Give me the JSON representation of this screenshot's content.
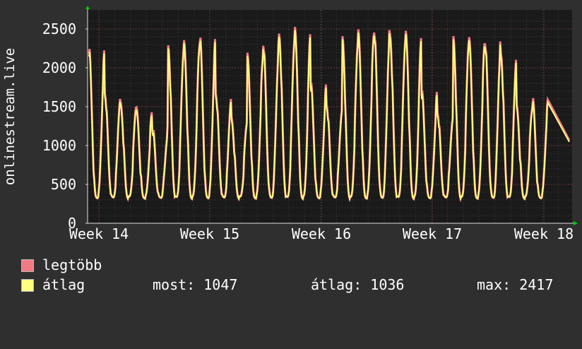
{
  "chart_data": {
    "type": "line",
    "ylabel": "onlinestream.live",
    "ylim": [
      0,
      2500
    ],
    "yticks": [
      0,
      500,
      1000,
      1500,
      2000,
      2500
    ],
    "xticks": [
      "Week 14",
      "Week 15",
      "Week 16",
      "Week 17",
      "Week 18"
    ],
    "grid": true,
    "legend_position": "bottom-left",
    "daily_peaks": [
      2200,
      1650,
      1500,
      1400,
      1200,
      2250,
      2280,
      2350,
      1650,
      1300,
      2100,
      2280,
      2400,
      2450,
      1750,
      1500,
      2350,
      2400,
      2450,
      2400,
      2400,
      1650,
      1400,
      2350,
      2300,
      2300,
      2150,
      1450,
      1550
    ],
    "daily_trough": 330,
    "last_value": 1047,
    "series": [
      {
        "name": "legtöbb",
        "color": "#f07b85"
      },
      {
        "name": "átlag",
        "color": "#ffff80"
      }
    ]
  },
  "legend": {
    "max_label": "legtöbb",
    "avg_label": "átlag",
    "now_text": "most: 1047",
    "avg_text": "átlag: 1036",
    "max_text": "max: 2417"
  }
}
